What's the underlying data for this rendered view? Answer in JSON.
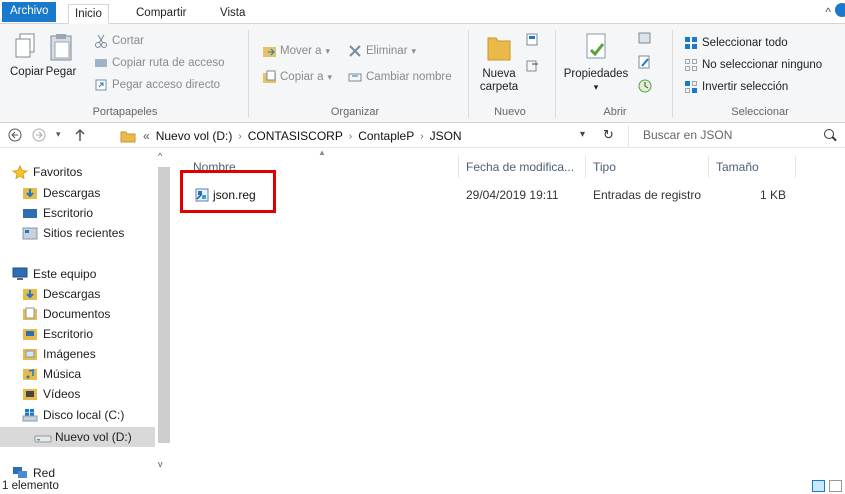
{
  "ribbon_tabs": {
    "file": "Archivo",
    "home": "Inicio",
    "share": "Compartir",
    "view": "Vista"
  },
  "clipboard": {
    "copy": "Copiar",
    "paste": "Pegar",
    "cut": "Cortar",
    "copy_path": "Copiar ruta de acceso",
    "paste_shortcut": "Pegar acceso directo",
    "label": "Portapapeles"
  },
  "organize": {
    "move_to": "Mover a",
    "copy_to": "Copiar a",
    "delete": "Eliminar",
    "rename": "Cambiar nombre",
    "label": "Organizar"
  },
  "new": {
    "new_folder_line1": "Nueva",
    "new_folder_line2": "carpeta",
    "label": "Nuevo"
  },
  "open": {
    "properties": "Propiedades",
    "label": "Abrir"
  },
  "select": {
    "select_all": "Seleccionar todo",
    "select_none": "No seleccionar ninguno",
    "invert": "Invertir selección",
    "label": "Seleccionar"
  },
  "address": {
    "overflow": "«",
    "crumbs": [
      "Nuevo vol (D:)",
      "CONTASISCORP",
      "ContapleP",
      "JSON"
    ]
  },
  "search": {
    "placeholder": "Buscar en JSON"
  },
  "nav_pane": {
    "favorites": "Favoritos",
    "fav_items": [
      "Descargas",
      "Escritorio",
      "Sitios recientes"
    ],
    "this_pc": "Este equipo",
    "pc_items": [
      "Descargas",
      "Documentos",
      "Escritorio",
      "Imágenes",
      "Música",
      "Vídeos",
      "Disco local (C:)",
      "Nuevo vol (D:)"
    ],
    "network": "Red"
  },
  "columns": {
    "name": "Nombre",
    "date": "Fecha de modifica...",
    "type": "Tipo",
    "size": "Tamaño"
  },
  "files": [
    {
      "name": "json.reg",
      "date": "29/04/2019 19:11",
      "type": "Entradas de registro",
      "size": "1 KB"
    }
  ],
  "status": {
    "count": "1 elemento"
  },
  "colors": {
    "accent": "#1979ca",
    "highlight_box": "#e10000"
  }
}
